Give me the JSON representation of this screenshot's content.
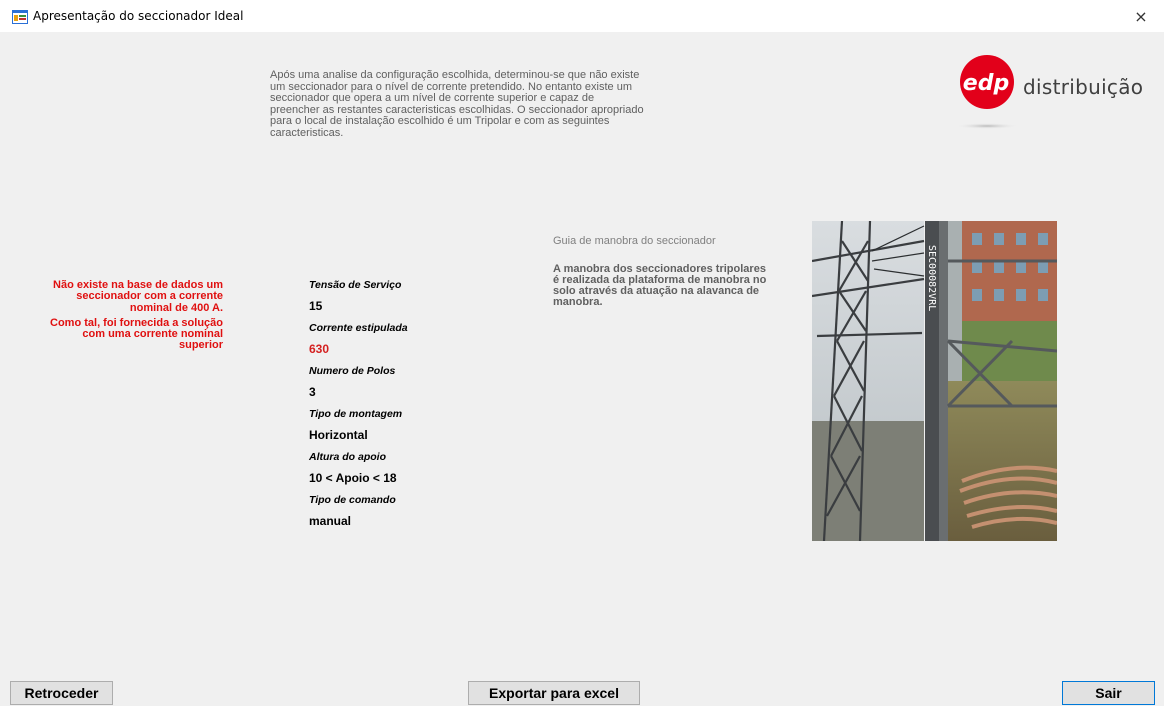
{
  "window": {
    "title": "Apresentação do seccionador Ideal",
    "close_glyph": "×"
  },
  "brand": {
    "logo_text": "edp",
    "wordmark": "distribuição",
    "color": "#e2001a"
  },
  "intro_text": "Após uma analise da configuração escolhida, determinou-se que não existe um seccionador para o nível de corrente pretendido. No entanto existe um seccionador que opera a um nível de corrente superior e capaz de preencher as restantes caracteristicas escolhidas. O seccionador apropriado para o local de instalação escolhido é um Tripolar e com as seguintes caracteristicas.",
  "warning": {
    "line1": "Não existe na base de dados um seccionador com a corrente nominal de 400 A.",
    "line2": "Como tal, foi fornecida a solução com uma corrente nominal superior",
    "color": "#e01010"
  },
  "specs": [
    {
      "label": "Tensão de Serviço",
      "value": "15"
    },
    {
      "label": "Corrente estipulada",
      "value": "630",
      "highlight": true
    },
    {
      "label": "Numero de Polos",
      "value": "3"
    },
    {
      "label": "Tipo de montagem",
      "value": "Horizontal"
    },
    {
      "label": "Altura do apoio",
      "value": "10 < Apoio < 18"
    },
    {
      "label": "Tipo de comando",
      "value": "manual"
    }
  ],
  "guide": {
    "title": "Guia de manobra do seccionador",
    "text": "A manobra dos seccionadores tripolares é realizada da plataforma de manobra no solo através da atuação na alavanca de manobra."
  },
  "photo": {
    "pole_marking": "SEC00082VRL"
  },
  "buttons": {
    "back": "Retroceder",
    "export": "Exportar para excel",
    "exit": "Sair"
  }
}
